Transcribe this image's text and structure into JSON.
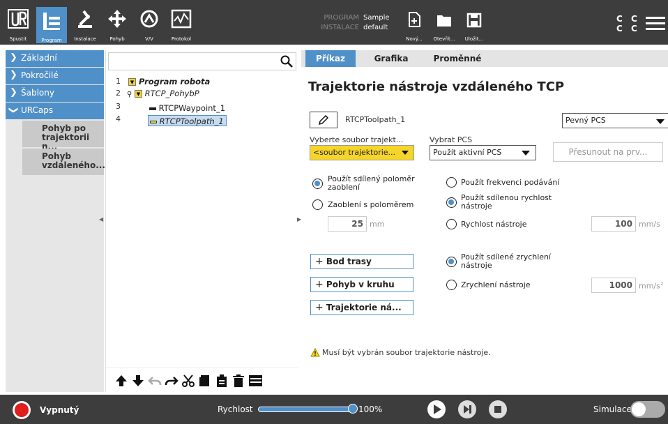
{
  "header": {
    "nav": [
      {
        "label": "Spustit",
        "icon": "ur-logo-icon"
      },
      {
        "label": "Program",
        "icon": "program-icon"
      },
      {
        "label": "Instalace",
        "icon": "robot-arm-icon"
      },
      {
        "label": "Pohyb",
        "icon": "move-arrows-icon"
      },
      {
        "label": "V/V",
        "icon": "io-icon"
      },
      {
        "label": "Protokol",
        "icon": "log-icon"
      }
    ],
    "program_key": "PROGRAM",
    "program_value": "Sample",
    "installation_key": "INSTALACE",
    "installation_value": "default",
    "file_buttons": [
      {
        "label": "Nový...",
        "icon": "new-file-icon"
      },
      {
        "label": "Otevřít...",
        "icon": "folder-icon"
      },
      {
        "label": "Uložit...",
        "icon": "save-icon"
      }
    ],
    "cc_top": "C C",
    "cc_bottom": "C C",
    "accent_color": "#5090c8"
  },
  "left_menu": {
    "items": [
      {
        "label": "Základní"
      },
      {
        "label": "Pokročilé"
      },
      {
        "label": "Šablony"
      },
      {
        "label": "URCaps"
      }
    ],
    "subitems": [
      {
        "line1": "Pohyb po",
        "line2": "trajektorii n..."
      },
      {
        "line1": "Pohyb",
        "line2": "vzdáleného..."
      }
    ]
  },
  "tree": {
    "rows": [
      {
        "num": "1",
        "label": "Program robota"
      },
      {
        "num": "2",
        "label": "RTCP_PohybP"
      },
      {
        "num": "3",
        "label": "RTCPWaypoint_1"
      },
      {
        "num": "4",
        "label": "RTCPToolpath_1"
      }
    ]
  },
  "right": {
    "tabs": [
      "Příkaz",
      "Grafika",
      "Proměnné"
    ],
    "title": "Trajektorie nástroje vzdáleného TCP",
    "name_value": "RTCPToolpath_1",
    "pcs_select": "Pevný PCS",
    "file_label": "Vyberte soubor trajekt...",
    "file_select": "<soubor trajektorie...",
    "pcs_label": "Vybrat PCS",
    "pcs_active": "Použít aktivní PCS",
    "move_button": "Přesunout na prv...",
    "radio_blend_shared_1": "Použít sdílený poloměr",
    "radio_blend_shared_2": "zaoblení",
    "radio_blend_radius": "Zaoblení s poloměrem",
    "blend_value": "25",
    "blend_unit": "mm",
    "radio_feed": "Použít frekvenci podávání",
    "radio_speed_shared_1": "Použít sdílenou rychlost",
    "radio_speed_shared_2": "nástroje",
    "radio_speed": "Rychlost nástroje",
    "speed_value": "100",
    "speed_unit": "mm/s",
    "btn_waypoint": "Bod trasy",
    "btn_circle": "Pohyb v kruhu",
    "btn_toolpath": "Trajektorie ná...",
    "radio_acc_shared_1": "Použít sdílené zrychlení",
    "radio_acc_shared_2": "nástroje",
    "radio_acc": "Zrychlení nástroje",
    "acc_value": "1000",
    "acc_unit": "mm/s",
    "acc_unit_sup": "2",
    "warning": "Musí být vybrán soubor trajektorie nástroje."
  },
  "footer": {
    "status": "Vypnutý",
    "speed_label": "Rychlost",
    "speed_percent": "100%",
    "speed_fraction": 1.0,
    "sim_label": "Simulace"
  }
}
